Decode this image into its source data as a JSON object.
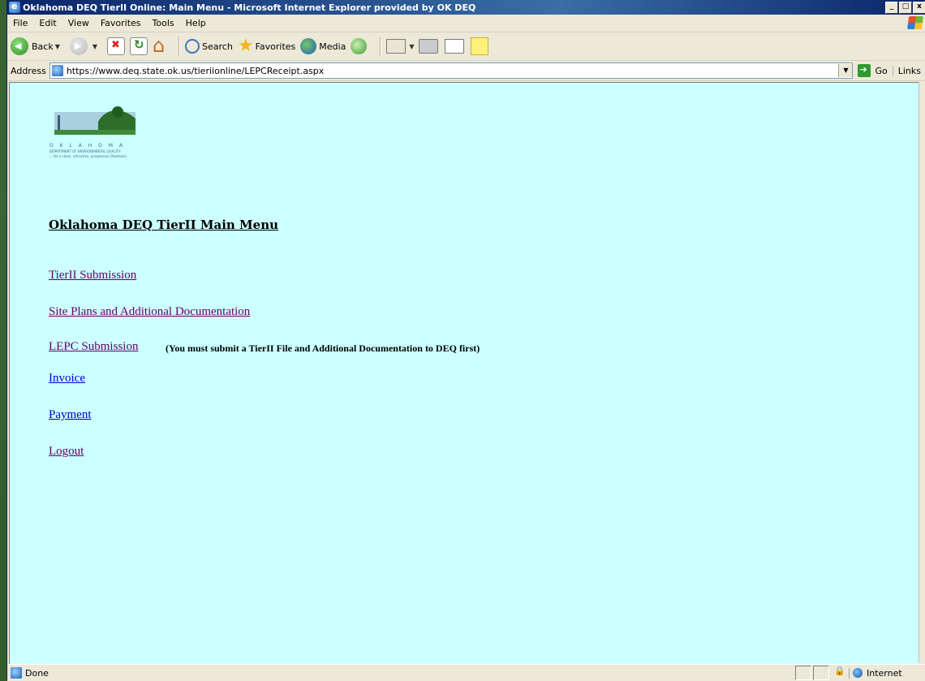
{
  "window": {
    "title": "Oklahoma DEQ TierII Online: Main Menu - Microsoft Internet Explorer provided by OK DEQ",
    "minimize_label": "_",
    "maximize_label": "□",
    "close_label": "x"
  },
  "menubar": {
    "items": [
      {
        "label": "File"
      },
      {
        "label": "Edit"
      },
      {
        "label": "View"
      },
      {
        "label": "Favorites"
      },
      {
        "label": "Tools"
      },
      {
        "label": "Help"
      }
    ]
  },
  "toolbar": {
    "back_label": "Back",
    "search_label": "Search",
    "favorites_label": "Favorites",
    "media_label": "Media"
  },
  "addressbar": {
    "label": "Address",
    "url": "https://www.deq.state.ok.us/tieriionline/LEPCReceipt.aspx",
    "go_label": "Go",
    "links_label": "Links"
  },
  "page": {
    "logo": {
      "text": "DEQ",
      "state_caption": "O K L A H O M A",
      "dept_caption": "DEPARTMENT OF ENVIRONMENTAL QUALITY",
      "tagline": "... for a clean, attractive, prosperous Oklahoma"
    },
    "title": "Oklahoma DEQ TierII Main Menu",
    "links": {
      "tierii_submission": "TierII Submission",
      "site_plans": "Site Plans and Additional Documentation",
      "lepc_submission": "LEPC Submission",
      "invoice": "Invoice",
      "payment": "Payment",
      "logout": "Logout"
    },
    "lepc_note": "(You must submit a TierII File and Additional Documentation to DEQ first)"
  },
  "statusbar": {
    "status": "Done",
    "zone": "Internet"
  },
  "colors": {
    "page_background": "#ccffff",
    "visited_link": "#660066",
    "unvisited_link": "#0000cc"
  }
}
